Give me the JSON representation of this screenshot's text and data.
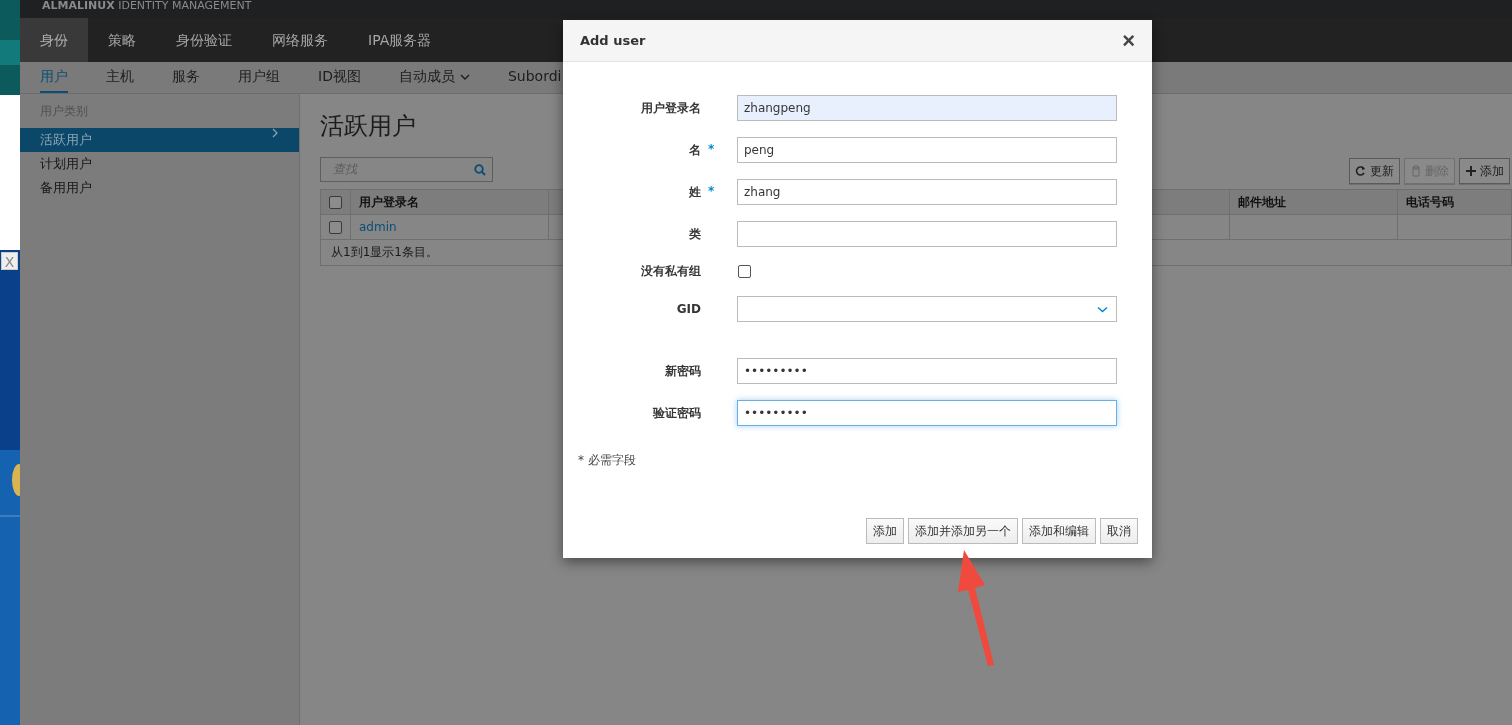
{
  "brand": "**ALMALINUX** IDENTITY MANAGEMENT",
  "side_strip": {
    "close": "X"
  },
  "nav_tabs": [
    {
      "label": "身份",
      "selected": true
    },
    {
      "label": "策略",
      "selected": false
    },
    {
      "label": "身份验证",
      "selected": false
    },
    {
      "label": "网络服务",
      "selected": false
    },
    {
      "label": "IPA服务器",
      "selected": false
    }
  ],
  "sub_tabs": [
    {
      "label": "用户",
      "selected": true,
      "dropdown": false
    },
    {
      "label": "主机",
      "selected": false,
      "dropdown": false
    },
    {
      "label": "服务",
      "selected": false,
      "dropdown": false
    },
    {
      "label": "用户组",
      "selected": false,
      "dropdown": false
    },
    {
      "label": "ID视图",
      "selected": false,
      "dropdown": false
    },
    {
      "label": "自动成员",
      "selected": false,
      "dropdown": true
    },
    {
      "label": "Subordi",
      "selected": false,
      "dropdown": false
    }
  ],
  "sidebar": {
    "heading": "用户类别",
    "items": [
      {
        "label": "活跃用户",
        "selected": true
      },
      {
        "label": "计划用户",
        "selected": false
      },
      {
        "label": "备用用户",
        "selected": false
      }
    ]
  },
  "page_title": "活跃用户",
  "search": {
    "placeholder": "查找"
  },
  "toolbar": [
    {
      "kind": "refresh",
      "label": "更新",
      "disabled": false
    },
    {
      "kind": "delete",
      "label": "删除",
      "disabled": true
    },
    {
      "kind": "add",
      "label": "添加",
      "disabled": false
    }
  ],
  "table": {
    "columns": [
      "用户登录名",
      "邮件地址",
      "电话号码"
    ],
    "all_checked": false,
    "rows": [
      {
        "checked": false,
        "login": "admin"
      }
    ],
    "footer": "从1到1显示1条目。"
  },
  "dialog": {
    "title": "Add user",
    "close": "×",
    "fields": [
      {
        "kind": "text",
        "label": "用户登录名",
        "required": false,
        "value": "zhangpeng",
        "autofilled": true,
        "focused": false
      },
      {
        "kind": "text",
        "label": "名",
        "required": true,
        "value": "peng",
        "autofilled": false,
        "focused": false
      },
      {
        "kind": "text",
        "label": "姓",
        "required": true,
        "value": "zhang",
        "autofilled": false,
        "focused": false
      },
      {
        "kind": "text",
        "label": "类",
        "required": false,
        "autofilled": false,
        "focused": false
      },
      {
        "kind": "checkbox",
        "label": "没有私有组",
        "checked": false
      },
      {
        "kind": "select",
        "label": "GID"
      },
      {
        "kind": "password",
        "label": "新密码",
        "required": false,
        "value": "•••••••••",
        "autofilled": false,
        "focused": false
      },
      {
        "kind": "password",
        "label": "验证密码",
        "required": false,
        "value": "•••••••••",
        "autofilled": false,
        "focused": true
      }
    ],
    "required_star": "*",
    "note": "* 必需字段",
    "buttons": [
      "添加",
      "添加并添加另一个",
      "添加和编辑",
      "取消"
    ]
  }
}
